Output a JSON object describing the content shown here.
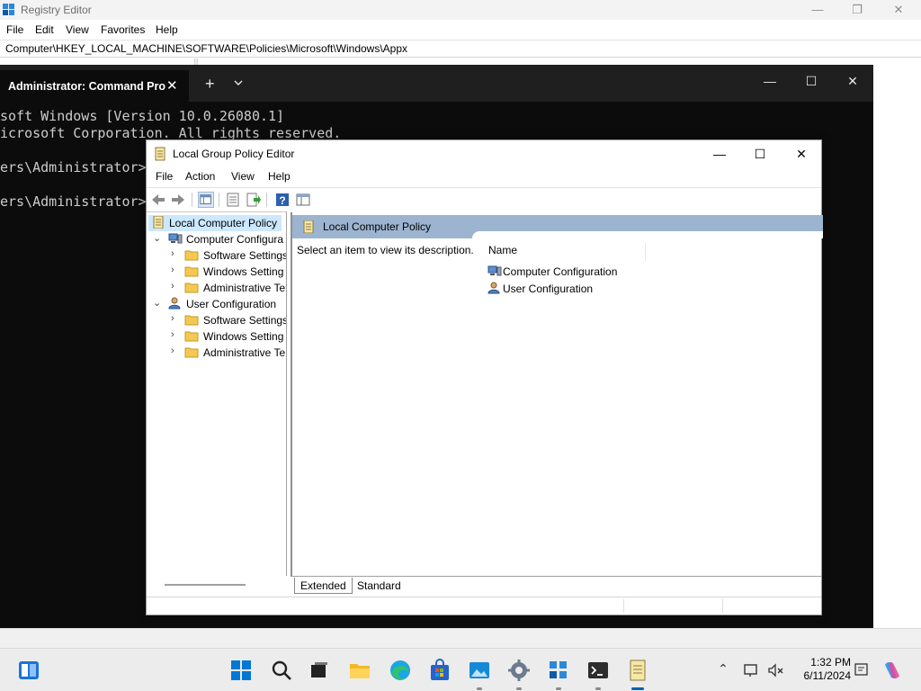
{
  "registry_editor": {
    "title": "Registry Editor",
    "menu": [
      "File",
      "Edit",
      "View",
      "Favorites",
      "Help"
    ],
    "address": "Computer\\HKEY_LOCAL_MACHINE\\SOFTWARE\\Policies\\Microsoft\\Windows\\Appx",
    "controls": {
      "minimize": "—",
      "maximize": "❐",
      "close": "✕"
    }
  },
  "terminal": {
    "tab_title": "Administrator: Command Pro",
    "tab_close": "✕",
    "new_tab": "+",
    "controls": {
      "minimize": "—",
      "maximize": "☐",
      "close": "✕"
    },
    "lines": [
      "soft Windows [Version 10.0.26080.1]",
      "icrosoft Corporation. All rights reserved.",
      "",
      "ers\\Administrator>g",
      "",
      "ers\\Administrator>"
    ]
  },
  "gpedit": {
    "title": "Local Group Policy Editor",
    "controls": {
      "minimize": "—",
      "maximize": "☐",
      "close": "✕"
    },
    "menu": [
      "File",
      "Action",
      "View",
      "Help"
    ],
    "tree": {
      "root": "Local Computer Policy",
      "computer_config": "Computer Configura",
      "user_config": "User Configuration",
      "computer_children": [
        "Software Settings",
        "Windows Setting",
        "Administrative Te"
      ],
      "user_children": [
        "Software Settings",
        "Windows Setting",
        "Administrative Te"
      ]
    },
    "right_pane": {
      "header": "Local Computer Policy",
      "description": "Select an item to view its description.",
      "column_name": "Name",
      "items": [
        "Computer Configuration",
        "User Configuration"
      ]
    },
    "view_tabs": [
      "Extended",
      "Standard"
    ],
    "active_tab": "Extended"
  },
  "taskbar": {
    "apps": [
      "start-icon",
      "search-icon",
      "task-view-icon",
      "file-explorer-icon",
      "edge-icon",
      "store-icon",
      "photos-icon",
      "settings-icon",
      "registry-editor-icon",
      "terminal-icon",
      "group-policy-icon"
    ],
    "time": "1:32 PM",
    "date": "6/11/2024"
  },
  "colors": {
    "accent": "#005fb8",
    "pane_header": "#9cb4d0",
    "tree_selection": "#cce8ff",
    "console_bg": "#0c0c0c"
  }
}
